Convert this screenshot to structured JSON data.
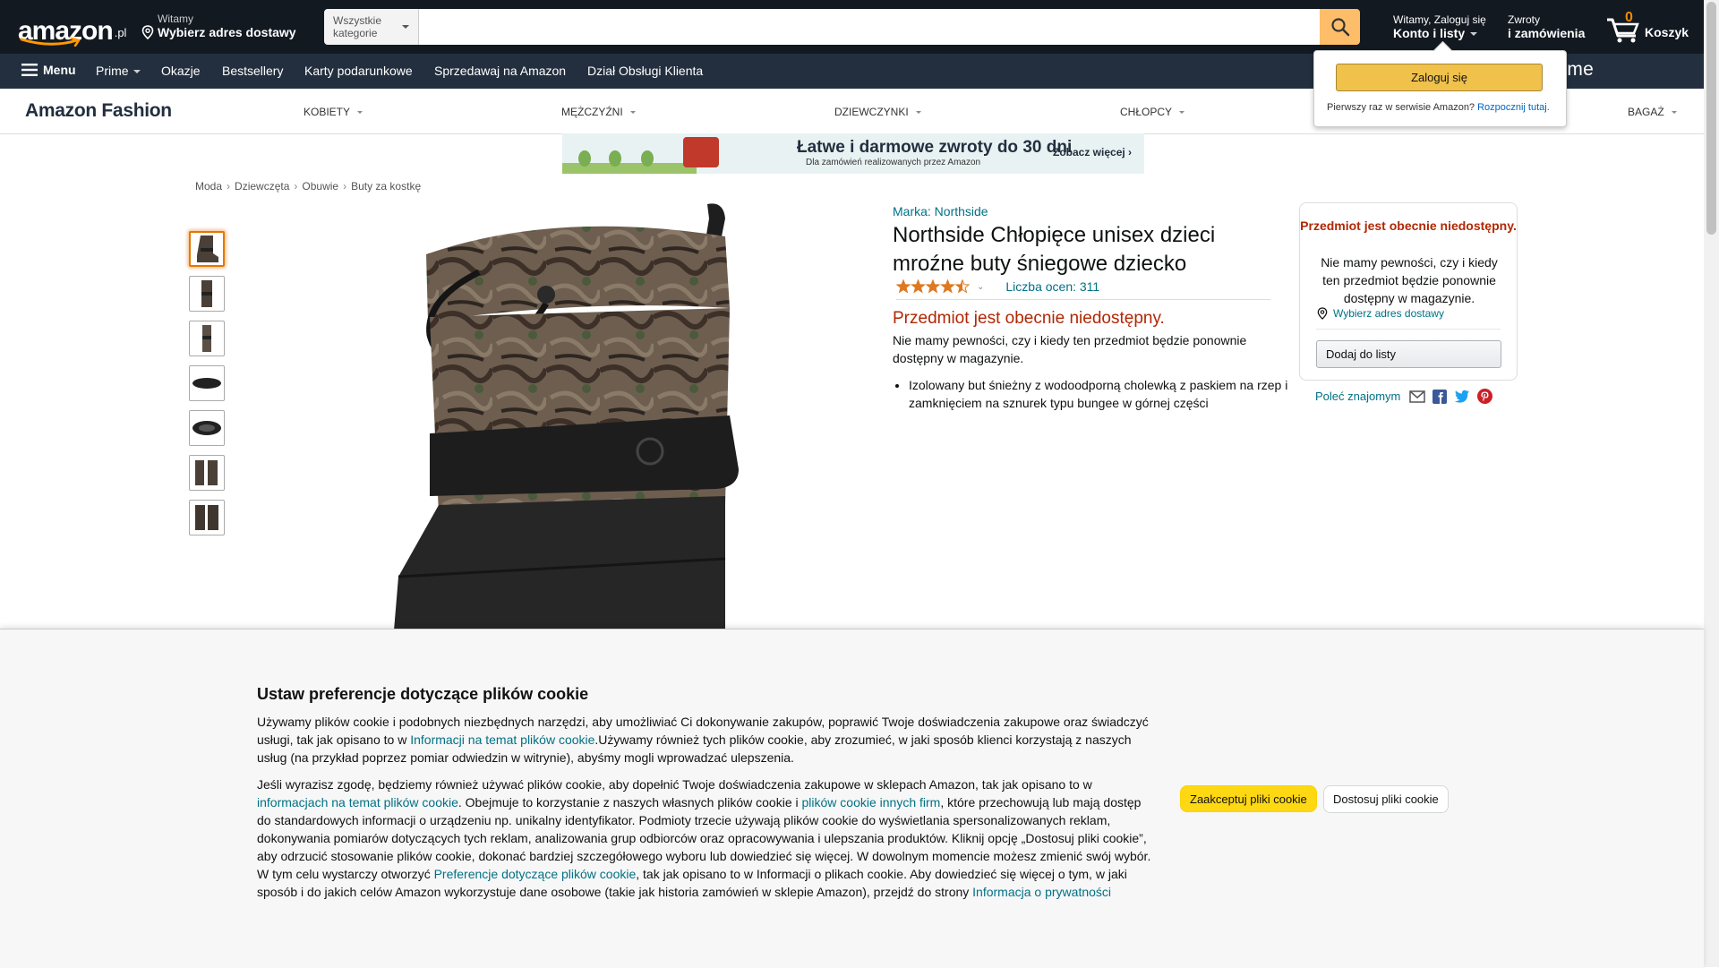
{
  "header": {
    "logo_text": "amazon",
    "logo_suffix": ".pl",
    "deliver_small": "Witamy",
    "deliver_big": "Wybierz adres dostawy",
    "search_category": "Wszystkie kategorie",
    "search_placeholder": "",
    "account_small": "Witamy, Zaloguj się",
    "account_big": "Konto i listy",
    "returns_small": "Zwroty",
    "returns_big": "i zamówienia",
    "cart_count": "0",
    "cart_label": "Koszyk"
  },
  "subnav": {
    "menu": "Menu",
    "items": [
      "Prime",
      "Okazje",
      "Bestsellery",
      "Karty podarunkowe",
      "Sprzedawaj na Amazon",
      "Dział Obsługi Klienta"
    ],
    "prime_banner": "Amazon prime"
  },
  "fashion": {
    "title": "Amazon Fashion",
    "categories": [
      "KOBIETY",
      "MĘŻCZYŹNI",
      "DZIEWCZYNKI",
      "CHŁOPCY",
      "BAGAŻ"
    ]
  },
  "signin_popover": {
    "button": "Zaloguj się",
    "new_customer": "Pierwszy raz w serwisie Amazon?",
    "start_here": "Rozpocznij tutaj."
  },
  "banner": {
    "main": "Łatwe i darmowe zwroty do 30 dni",
    "sub": "Dla zamówień realizowanych przez Amazon",
    "more": "Zobacz więcej ›"
  },
  "breadcrumb": [
    "Moda",
    "Dziewczęta",
    "Obuwie",
    "Buty za kostkę"
  ],
  "product": {
    "brand": "Marka: Northside",
    "title": "Northside Chłopięce unisex dzieci mroźne buty śniegowe dziecko",
    "rating_value": 4.5,
    "rating_count": "Liczba ocen: 311",
    "unavailable": "Przedmiot jest obecnie niedostępny.",
    "unavailable_note": "Nie mamy pewności, czy i kiedy ten przedmiot będzie ponownie dostępny w magazynie.",
    "bullets": [
      "Izolowany but śnieżny z wodoodporną cholewką z paskiem na rzep i zamknięciem na sznurek typu bungee w górnej części"
    ],
    "thumbnail_count": 7
  },
  "buybox": {
    "unavailable": "Przedmiot jest obecnie niedostępny.",
    "note": "Nie mamy pewności, czy i kiedy ten przedmiot będzie ponownie dostępny w magazynie.",
    "address": "Wybierz adres dostawy",
    "add_to_list": "Dodaj do listy"
  },
  "share": {
    "label": "Poleć znajomym"
  },
  "cookie": {
    "title": "Ustaw preferencje dotyczące plików cookie",
    "p1_a": "Używamy plików cookie i podobnych niezbędnych narzędzi, aby umożliwiać Ci dokonywanie zakupów, poprawić Twoje doświadczenia zakupowe oraz świadczyć usługi, tak jak opisano to w ",
    "p1_link": "Informacji na temat plików cookie",
    "p1_b": ".Używamy również tych plików cookie, aby zrozumieć, w jaki sposób klienci korzystają z naszych usług (na przykład poprzez pomiar odwiedzin w witrynie), abyśmy mogli wprowadzać ulepszenia.",
    "p2_a": "Jeśli wyrazisz zgodę, będziemy również używać plików cookie, aby dopełnić Twoje doświadczenia zakupowe w sklepach Amazon, tak jak opisano to w ",
    "p2_link1": "informacjach na temat plików cookie",
    "p2_b": ". Obejmuje to korzystanie z naszych własnych plików cookie i ",
    "p2_link2": "plików cookie innych firm",
    "p2_c": ", które przechowują lub mają dostęp do standardowych informacji o urządzeniu np. unikalny identyfikator. Podmioty trzecie używają plików cookie do wyświetlania spersonalizowanych reklam, dokonywania pomiarów dotyczących tych reklam, analizowania grup odbiorców oraz opracowywania i ulepszania produktów. Kliknij opcję „Dostosuj pliki cookie”, aby odrzucić stosowanie plików cookie, dokonać bardziej szczegółowego wyboru lub dowiedzieć się więcej. W dowolnym momencie możesz zmienić swój wybór. W tym celu wystarczy otworzyć ",
    "p2_link3": "Preferencje dotyczące plików cookie",
    "p2_d": ", tak jak opisano to w Informacji o plikach cookie. Aby dowiedzieć się więcej o tym, w jaki sposób i do jakich celów Amazon wykorzystuje dane osobowe (takie jak historia zamówień w sklepie Amazon), przejdź do strony ",
    "p2_link4": "Informacja o prywatności",
    "accept": "Zaakceptuj pliki cookie",
    "customize": "Dostosuj pliki cookie"
  },
  "colors": {
    "nav_dark": "#131921",
    "nav_secondary": "#232f3e",
    "search_button": "#febd69",
    "link": "#007185",
    "unavailable": "#b12704",
    "star": "#de7921",
    "accept_button": "#ffd814"
  }
}
